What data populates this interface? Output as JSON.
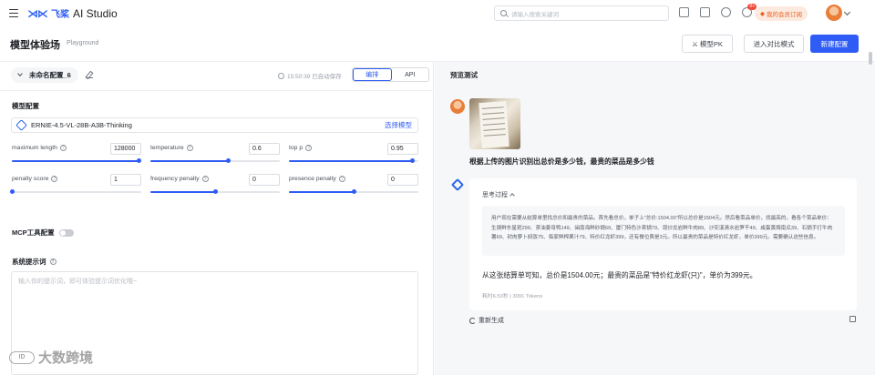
{
  "app": {
    "logo_mark": "飞桨",
    "logo_cn": "飞桨",
    "logo_en": "AI Studio",
    "search_placeholder": "请输入搜索关键词",
    "notification_count": "9+",
    "member_label": "我的会员订阅"
  },
  "page": {
    "title": "模型体验场",
    "subtitle": "Playground",
    "btn_pk": "模型PK",
    "btn_compare": "进入对比模式",
    "btn_new": "新建配置"
  },
  "config": {
    "name": "未命名配置_6",
    "saved_text": "15:50:39 已自动保存",
    "tab_edit": "编排",
    "tab_api": "API",
    "section_model": "模型配置",
    "model_name": "ERNIE-4.5-VL-28B-A3B-Thinking",
    "model_pick": "选择模型",
    "params": [
      {
        "label": "maximum length",
        "value": "128000",
        "level": 0.98
      },
      {
        "label": "temperature",
        "value": "0.6",
        "level": 0.6
      },
      {
        "label": "top p",
        "value": "0.95",
        "level": 0.95
      },
      {
        "label": "penalty score",
        "value": "1",
        "level": 0.0
      },
      {
        "label": "frequency penalty",
        "value": "0",
        "level": 0.5
      },
      {
        "label": "presence penalty",
        "value": "0",
        "level": 0.5
      }
    ],
    "mcp_label": "MCP工具配置",
    "mcp_enabled": false,
    "system_prompt_title": "系统提示词",
    "system_prompt_placeholder": "输入你的提示词，即可体验提示词优化哦~"
  },
  "preview": {
    "title": "预览测试",
    "question": "根据上传的图片识别出总价是多少钱，最贵的菜品是多少钱",
    "thinking_label": "思考过程",
    "thinking_text": "用户现在需要从结算单里找总价和最贵的菜品。首先看总价，单子上\"总价:1504.00\"所以总价是1504元。然后看菜品单价，找最高的。看各个菜品单价：生焗鲜东星斑299、茶油姜母鸭149、闽南海鲜砂锅69、厦门特色沙茶锅79、现炒龙岩鲜牛肉89、沙安溪清水岩笋干49、咸蛋黄焗南瓜39、石锅手打牛肉薯69、封肉萝卜焖饭75、临家鲜榨果汁79、特价红龙虾399，还有餐位费是3元。所以最贵的菜品是特价红龙虾，单价399元。需要确认这些信息。",
    "final_answer": "从这张结算单可知，总价是1504.00元；最贵的菜品是\"特价红龙虾(只)\"，单价为399元。",
    "stats": "耗时6.53秒 | 3091 Tokens",
    "regenerate": "重新生成"
  },
  "watermark": {
    "text": "大数跨境",
    "mark": "ID"
  },
  "colors": {
    "accent": "#2f5cf5",
    "member": "#e5601f"
  }
}
